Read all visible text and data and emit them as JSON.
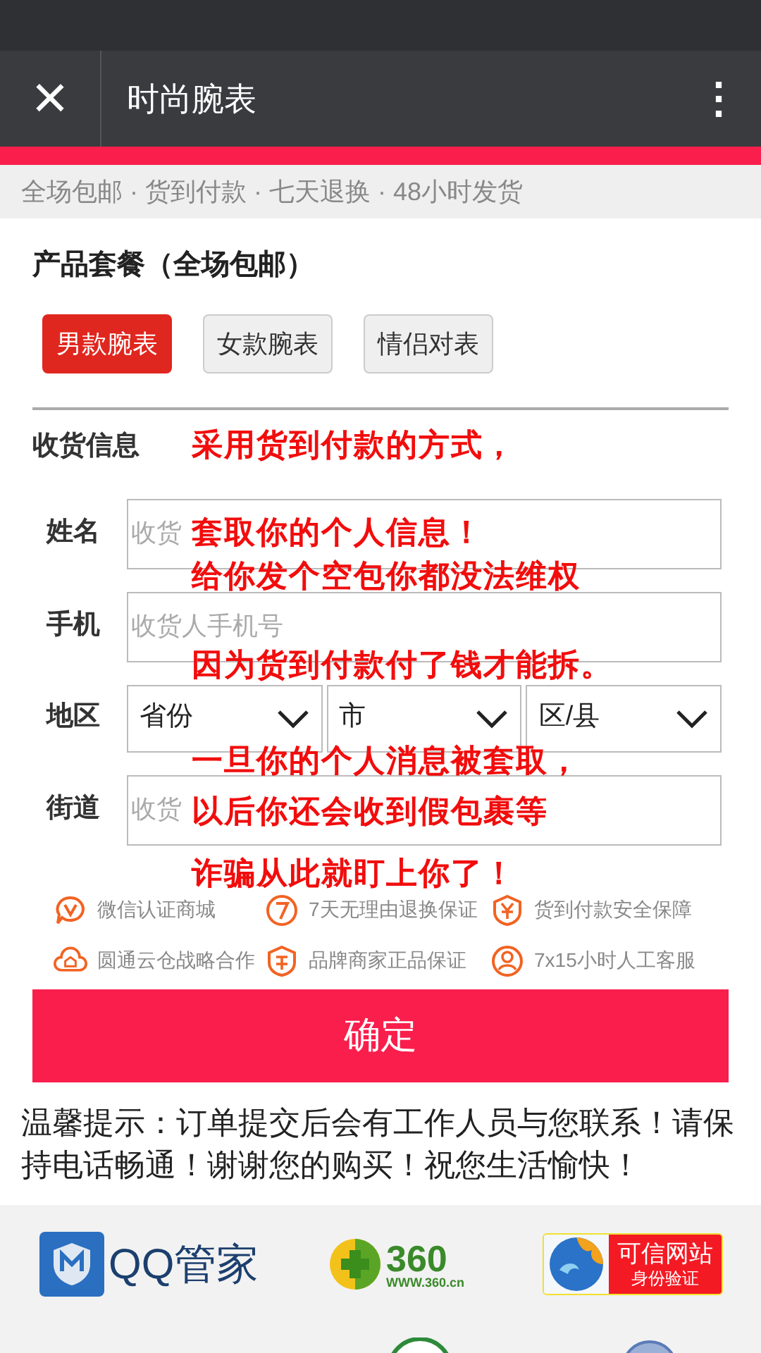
{
  "app_bar": {
    "close_icon": "×",
    "title": "时尚腕表",
    "menu_icon": "⋮"
  },
  "notice": "全场包邮 · 货到付款 · 七天退换 · 48小时发货",
  "package": {
    "heading": "产品套餐（全场包邮）",
    "options": [
      {
        "label": "男款腕表",
        "selected": true
      },
      {
        "label": "女款腕表",
        "selected": false
      },
      {
        "label": "情侣对表",
        "selected": false
      }
    ]
  },
  "shipping": {
    "heading": "收货信息",
    "fields": [
      {
        "kind": "text",
        "label": "姓名",
        "placeholder": "收货"
      },
      {
        "kind": "text",
        "label": "手机",
        "placeholder": "收货人手机号"
      },
      {
        "kind": "selects",
        "label": "地区",
        "options": [
          "省份",
          "市",
          "区/县"
        ]
      },
      {
        "kind": "text",
        "label": "街道",
        "placeholder": "收货"
      }
    ]
  },
  "guarantees": [
    "微信认证商城",
    "7天无理由退换保证",
    "货到付款安全保障",
    "圆通云仓战略合作",
    "品牌商家正品保证",
    "7x15小时人工客服"
  ],
  "confirm_button": "确定",
  "tip": "温馨提示：订单提交后会有工作人员与您联系！请保持电话畅通！谢谢您的购买！祝您生活愉快！",
  "badges": [
    {
      "kind": "shieldlogo",
      "text": "QQ管家"
    },
    {
      "kind": "balllogo",
      "text": "360",
      "sub": "WWW.360.cn"
    },
    {
      "kind": "trustlogo",
      "text": "可信网站",
      "sub": "身份验证"
    }
  ],
  "overlay_lines": [
    "采用货到付款的方式，",
    "套取你的个人信息！",
    "给你发个空包你都没法维权",
    "因为货到付款付了钱才能拆。",
    "一旦你的个人消息被套取，",
    "以后你还会收到假包裹等",
    "诈骗从此就盯上你了！"
  ]
}
